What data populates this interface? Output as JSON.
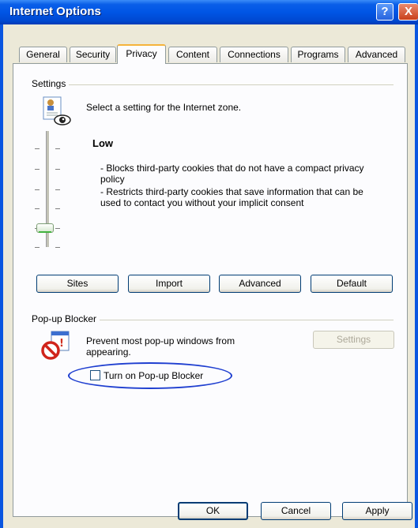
{
  "window": {
    "title": "Internet Options",
    "help_glyph": "?",
    "close_glyph": "X"
  },
  "tabs": [
    {
      "label": "General"
    },
    {
      "label": "Security"
    },
    {
      "label": "Privacy"
    },
    {
      "label": "Content"
    },
    {
      "label": "Connections"
    },
    {
      "label": "Programs"
    },
    {
      "label": "Advanced"
    }
  ],
  "settings": {
    "group_label": "Settings",
    "description": "Select a setting for the Internet zone.",
    "level_title": "Low",
    "level_desc_1": "- Blocks third-party cookies that do not have a compact privacy policy",
    "level_desc_2": "- Restricts third-party cookies that save information that can be used to contact you without your implicit consent",
    "buttons": {
      "sites": "Sites",
      "import": "Import",
      "advanced": "Advanced",
      "default": "Default"
    }
  },
  "popup": {
    "group_label": "Pop-up Blocker",
    "description": "Prevent most pop-up windows from appearing.",
    "settings_button": "Settings",
    "checkbox_label": "Turn on Pop-up Blocker",
    "checkbox_checked": false
  },
  "footer": {
    "ok": "OK",
    "cancel": "Cancel",
    "apply": "Apply"
  },
  "colors": {
    "titlebar": "#0055e5",
    "dialog_bg": "#ece9d8",
    "panel_bg": "#fcfcfe",
    "highlight_ellipse": "#1f3fd0",
    "tab_accent": "#f5b33b"
  }
}
